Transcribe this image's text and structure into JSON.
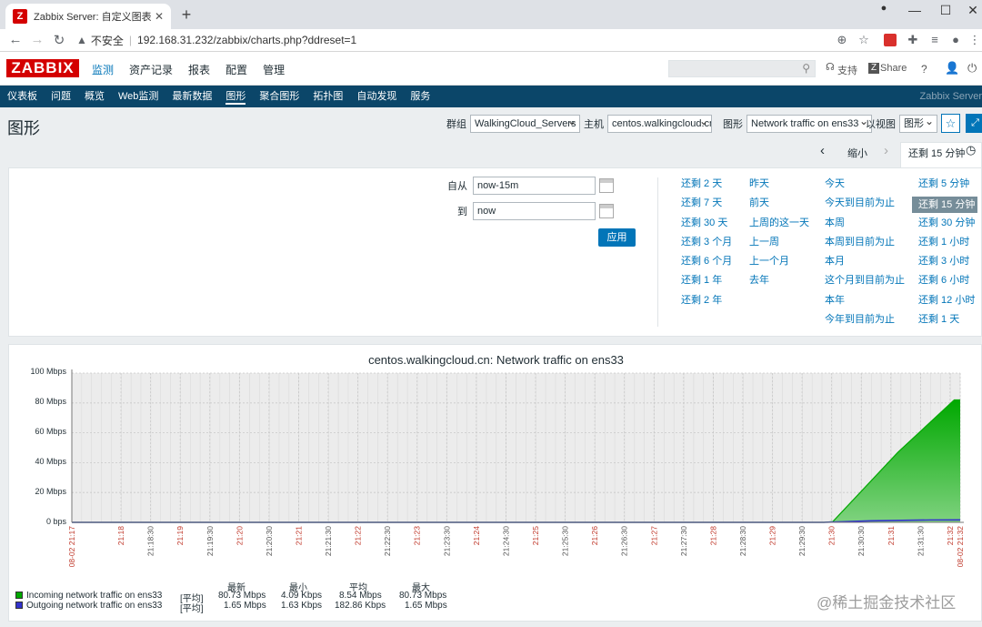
{
  "browser": {
    "tab_title": "Zabbix Server: 自定义图表 [每",
    "url_prefix": "不安全",
    "url": "192.168.31.232/zabbix/charts.php?ddreset=1"
  },
  "header": {
    "logo": "ZABBIX",
    "menu": [
      "监测",
      "资产记录",
      "报表",
      "配置",
      "管理"
    ],
    "support": "支持",
    "share": "Share",
    "help": "?"
  },
  "submenu": {
    "items": [
      "仪表板",
      "问题",
      "概览",
      "Web监测",
      "最新数据",
      "图形",
      "聚合图形",
      "拓扑图",
      "自动发现",
      "服务"
    ],
    "brand": "Zabbix Server"
  },
  "page": {
    "title": "图形",
    "group_label": "群组",
    "group_value": "WalkingCloud_Servers",
    "host_label": "主机",
    "host_value": "centos.walkingcloud.cn",
    "graph_label": "图形",
    "graph_value": "Network traffic on ens33",
    "view_label": "以视图",
    "view_value": "图形"
  },
  "time": {
    "prev": "‹",
    "zoom_out": "缩小",
    "next": "›",
    "active_tab": "还剩 15 分钟",
    "from_label": "自从",
    "from_value": "now-15m",
    "to_label": "到",
    "to_value": "now",
    "apply": "应用",
    "quick": [
      [
        "还剩 2 天",
        "还剩 7 天",
        "还剩 30 天",
        "还剩 3 个月",
        "还剩 6 个月",
        "还剩 1 年",
        "还剩 2 年"
      ],
      [
        "昨天",
        "前天",
        "上周的这一天",
        "上一周",
        "上一个月",
        "去年"
      ],
      [
        "今天",
        "今天到目前为止",
        "本周",
        "本周到目前为止",
        "本月",
        "这个月到目前为止",
        "本年",
        "今年到目前为止"
      ],
      [
        "还剩 5 分钟",
        "还剩 15 分钟",
        "还剩 30 分钟",
        "还剩 1 小时",
        "还剩 3 小时",
        "还剩 6 小时",
        "还剩 12 小时",
        "还剩 1 天"
      ]
    ]
  },
  "chart_data": {
    "type": "area",
    "title": "centos.walkingcloud.cn: Network traffic on ens33",
    "y_ticks": [
      "100 Mbps",
      "80 Mbps",
      "60 Mbps",
      "40 Mbps",
      "20 Mbps",
      "0 bps"
    ],
    "ylim": [
      0,
      100
    ],
    "x_ticks": [
      "08-02 21:17",
      "21:18",
      "21:18:30",
      "21:19",
      "21:19:30",
      "21:20",
      "21:20:30",
      "21:21",
      "21:21:30",
      "21:22",
      "21:22:30",
      "21:23",
      "21:23:30",
      "21:24",
      "21:24:30",
      "21:25",
      "21:25:30",
      "21:26",
      "21:26:30",
      "21:27",
      "21:27:30",
      "21:28",
      "21:28:30",
      "21:29",
      "21:29:30",
      "21:30",
      "21:30:30",
      "21:31",
      "21:31:30",
      "21:32",
      "08-02 21:32"
    ],
    "x_tick_colors": [
      "#c0392b",
      "#c0392b",
      "#555",
      "#c0392b",
      "#555",
      "#c0392b",
      "#555",
      "#c0392b",
      "#555",
      "#c0392b",
      "#555",
      "#c0392b",
      "#555",
      "#c0392b",
      "#555",
      "#c0392b",
      "#555",
      "#c0392b",
      "#555",
      "#c0392b",
      "#555",
      "#c0392b",
      "#555",
      "#c0392b",
      "#555",
      "#c0392b",
      "#555",
      "#c0392b",
      "#555",
      "#c0392b",
      "#c0392b"
    ],
    "x_minutes": [
      0,
      0.83,
      1.33,
      1.83,
      2.33,
      2.83,
      3.33,
      3.83,
      4.33,
      4.83,
      5.33,
      5.83,
      6.33,
      6.83,
      7.33,
      7.83,
      8.33,
      8.83,
      9.33,
      9.83,
      10.33,
      10.83,
      11.33,
      11.83,
      12.33,
      12.83,
      13.33,
      13.83,
      14.33,
      14.83,
      15
    ],
    "series": [
      {
        "name": "Incoming network traffic on ens33",
        "color": "#00a800",
        "x_minutes": [
          0,
          12.7,
          12.85,
          13.95,
          14.9,
          15
        ],
        "values": [
          0,
          0,
          0.5,
          47,
          82,
          82
        ]
      },
      {
        "name": "Outgoing network traffic on ens33",
        "color": "#3333cc",
        "x_minutes": [
          0,
          12.7,
          13.5,
          14.5,
          15
        ],
        "values": [
          0,
          0,
          1.0,
          1.6,
          1.65
        ]
      }
    ],
    "legend_headers": [
      "最新",
      "最小",
      "平均",
      "最大"
    ],
    "legend_rows": [
      {
        "name": "Incoming network traffic on ens33",
        "func": "[平均]",
        "last": "80.73 Mbps",
        "min": "4.09 Kbps",
        "avg": "8.54 Mbps",
        "max": "80.73 Mbps",
        "color": "#00a800"
      },
      {
        "name": "Outgoing network traffic on ens33",
        "func": "[平均]",
        "last": "1.65 Mbps",
        "min": "1.63 Kbps",
        "avg": "182.86 Kbps",
        "max": "1.65 Mbps",
        "color": "#3333cc"
      }
    ]
  },
  "watermark": "@稀土掘金技术社区"
}
